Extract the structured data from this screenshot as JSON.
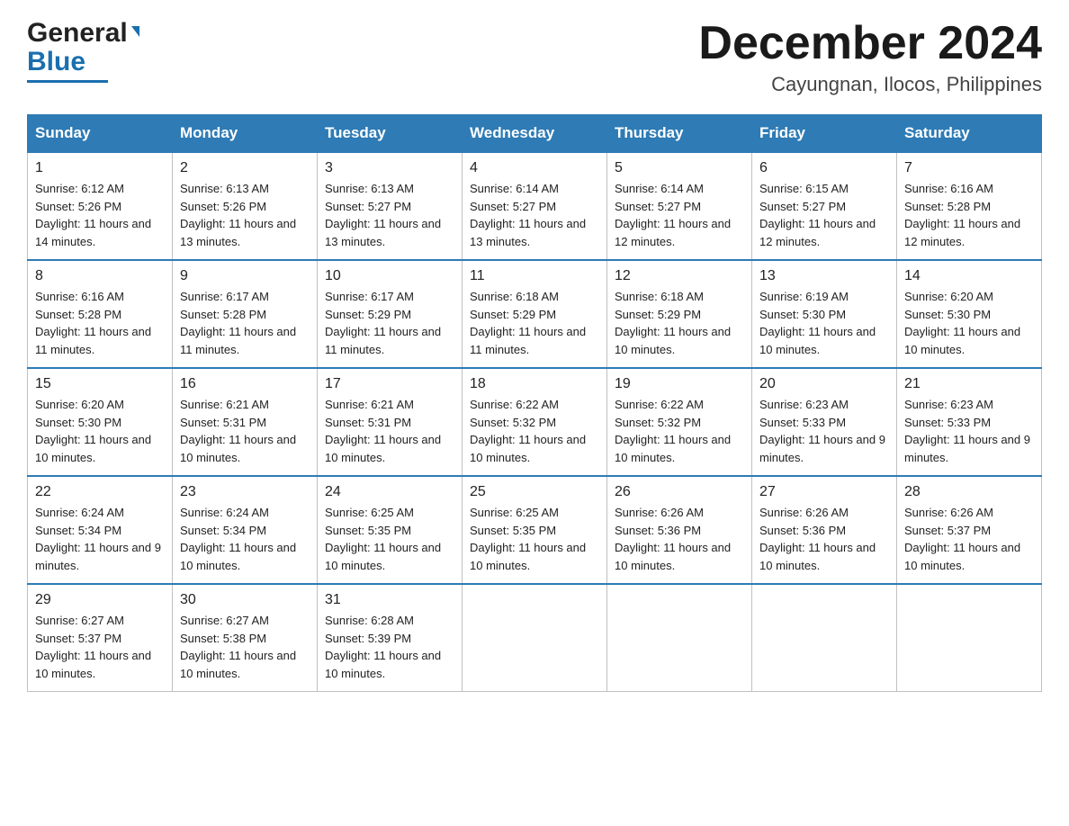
{
  "logo": {
    "general": "General",
    "blue": "Blue"
  },
  "title": "December 2024",
  "location": "Cayungnan, Ilocos, Philippines",
  "days_of_week": [
    "Sunday",
    "Monday",
    "Tuesday",
    "Wednesday",
    "Thursday",
    "Friday",
    "Saturday"
  ],
  "weeks": [
    [
      {
        "day": "1",
        "sunrise": "6:12 AM",
        "sunset": "5:26 PM",
        "daylight": "11 hours and 14 minutes."
      },
      {
        "day": "2",
        "sunrise": "6:13 AM",
        "sunset": "5:26 PM",
        "daylight": "11 hours and 13 minutes."
      },
      {
        "day": "3",
        "sunrise": "6:13 AM",
        "sunset": "5:27 PM",
        "daylight": "11 hours and 13 minutes."
      },
      {
        "day": "4",
        "sunrise": "6:14 AM",
        "sunset": "5:27 PM",
        "daylight": "11 hours and 13 minutes."
      },
      {
        "day": "5",
        "sunrise": "6:14 AM",
        "sunset": "5:27 PM",
        "daylight": "11 hours and 12 minutes."
      },
      {
        "day": "6",
        "sunrise": "6:15 AM",
        "sunset": "5:27 PM",
        "daylight": "11 hours and 12 minutes."
      },
      {
        "day": "7",
        "sunrise": "6:16 AM",
        "sunset": "5:28 PM",
        "daylight": "11 hours and 12 minutes."
      }
    ],
    [
      {
        "day": "8",
        "sunrise": "6:16 AM",
        "sunset": "5:28 PM",
        "daylight": "11 hours and 11 minutes."
      },
      {
        "day": "9",
        "sunrise": "6:17 AM",
        "sunset": "5:28 PM",
        "daylight": "11 hours and 11 minutes."
      },
      {
        "day": "10",
        "sunrise": "6:17 AM",
        "sunset": "5:29 PM",
        "daylight": "11 hours and 11 minutes."
      },
      {
        "day": "11",
        "sunrise": "6:18 AM",
        "sunset": "5:29 PM",
        "daylight": "11 hours and 11 minutes."
      },
      {
        "day": "12",
        "sunrise": "6:18 AM",
        "sunset": "5:29 PM",
        "daylight": "11 hours and 10 minutes."
      },
      {
        "day": "13",
        "sunrise": "6:19 AM",
        "sunset": "5:30 PM",
        "daylight": "11 hours and 10 minutes."
      },
      {
        "day": "14",
        "sunrise": "6:20 AM",
        "sunset": "5:30 PM",
        "daylight": "11 hours and 10 minutes."
      }
    ],
    [
      {
        "day": "15",
        "sunrise": "6:20 AM",
        "sunset": "5:30 PM",
        "daylight": "11 hours and 10 minutes."
      },
      {
        "day": "16",
        "sunrise": "6:21 AM",
        "sunset": "5:31 PM",
        "daylight": "11 hours and 10 minutes."
      },
      {
        "day": "17",
        "sunrise": "6:21 AM",
        "sunset": "5:31 PM",
        "daylight": "11 hours and 10 minutes."
      },
      {
        "day": "18",
        "sunrise": "6:22 AM",
        "sunset": "5:32 PM",
        "daylight": "11 hours and 10 minutes."
      },
      {
        "day": "19",
        "sunrise": "6:22 AM",
        "sunset": "5:32 PM",
        "daylight": "11 hours and 10 minutes."
      },
      {
        "day": "20",
        "sunrise": "6:23 AM",
        "sunset": "5:33 PM",
        "daylight": "11 hours and 9 minutes."
      },
      {
        "day": "21",
        "sunrise": "6:23 AM",
        "sunset": "5:33 PM",
        "daylight": "11 hours and 9 minutes."
      }
    ],
    [
      {
        "day": "22",
        "sunrise": "6:24 AM",
        "sunset": "5:34 PM",
        "daylight": "11 hours and 9 minutes."
      },
      {
        "day": "23",
        "sunrise": "6:24 AM",
        "sunset": "5:34 PM",
        "daylight": "11 hours and 10 minutes."
      },
      {
        "day": "24",
        "sunrise": "6:25 AM",
        "sunset": "5:35 PM",
        "daylight": "11 hours and 10 minutes."
      },
      {
        "day": "25",
        "sunrise": "6:25 AM",
        "sunset": "5:35 PM",
        "daylight": "11 hours and 10 minutes."
      },
      {
        "day": "26",
        "sunrise": "6:26 AM",
        "sunset": "5:36 PM",
        "daylight": "11 hours and 10 minutes."
      },
      {
        "day": "27",
        "sunrise": "6:26 AM",
        "sunset": "5:36 PM",
        "daylight": "11 hours and 10 minutes."
      },
      {
        "day": "28",
        "sunrise": "6:26 AM",
        "sunset": "5:37 PM",
        "daylight": "11 hours and 10 minutes."
      }
    ],
    [
      {
        "day": "29",
        "sunrise": "6:27 AM",
        "sunset": "5:37 PM",
        "daylight": "11 hours and 10 minutes."
      },
      {
        "day": "30",
        "sunrise": "6:27 AM",
        "sunset": "5:38 PM",
        "daylight": "11 hours and 10 minutes."
      },
      {
        "day": "31",
        "sunrise": "6:28 AM",
        "sunset": "5:39 PM",
        "daylight": "11 hours and 10 minutes."
      },
      null,
      null,
      null,
      null
    ]
  ]
}
